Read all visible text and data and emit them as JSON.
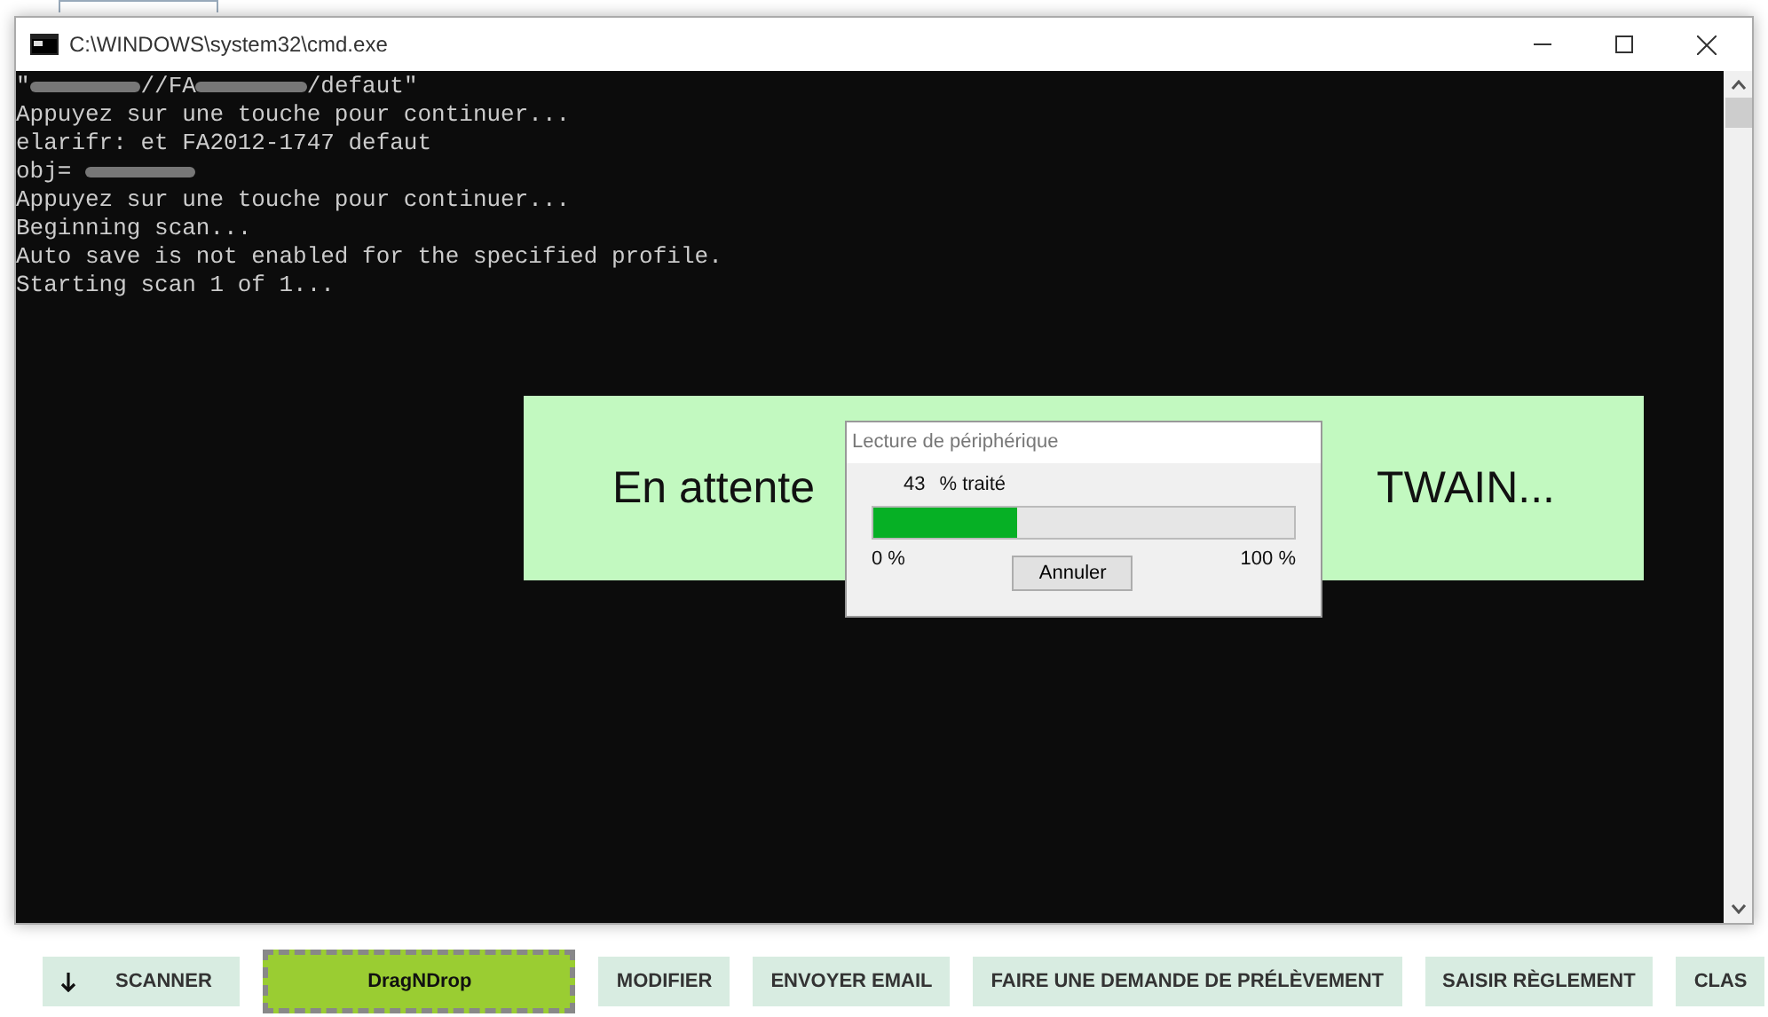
{
  "window": {
    "title": "C:\\WINDOWS\\system32\\cmd.exe"
  },
  "console": {
    "lines": [
      [
        {
          "kind": "text",
          "text": "\""
        },
        {
          "kind": "redacted"
        },
        {
          "kind": "text",
          "text": "//FA"
        },
        {
          "kind": "redacted"
        },
        {
          "kind": "text",
          "text": "/defaut\""
        }
      ],
      [
        {
          "kind": "text",
          "text": "Appuyez sur une touche pour continuer..."
        }
      ],
      [
        {
          "kind": "text",
          "text": "elarifr: et FA2012-1747 defaut"
        }
      ],
      [
        {
          "kind": "text",
          "text": "obj= "
        },
        {
          "kind": "redacted"
        }
      ],
      [
        {
          "kind": "text",
          "text": "Appuyez sur une touche pour continuer..."
        }
      ],
      [
        {
          "kind": "text",
          "text": "Beginning scan..."
        }
      ],
      [
        {
          "kind": "text",
          "text": "Auto save is not enabled for the specified profile."
        }
      ],
      [
        {
          "kind": "text",
          "text": "Starting scan 1 of 1..."
        }
      ]
    ]
  },
  "banner": {
    "left_text": "En attente",
    "right_text": "TWAIN..."
  },
  "progress_dialog": {
    "title": "Lecture de périphérique",
    "value": "43",
    "caption": "% traité",
    "level": 0.34,
    "min_label": "0 %",
    "max_label": "100 %",
    "cancel": "Annuler"
  },
  "toolbar": [
    {
      "kind": "icon",
      "label": "SCANNER"
    },
    {
      "kind": "drop",
      "label": "DragNDrop"
    },
    {
      "kind": "plain",
      "label": "MODIFIER"
    },
    {
      "kind": "plain",
      "label": "ENVOYER EMAIL"
    },
    {
      "kind": "plain",
      "label": "FAIRE UNE DEMANDE DE PRÉLÈVEMENT"
    },
    {
      "kind": "plain",
      "label": "SAISIR RÈGLEMENT"
    },
    {
      "kind": "plain",
      "label": "CLAS"
    }
  ]
}
